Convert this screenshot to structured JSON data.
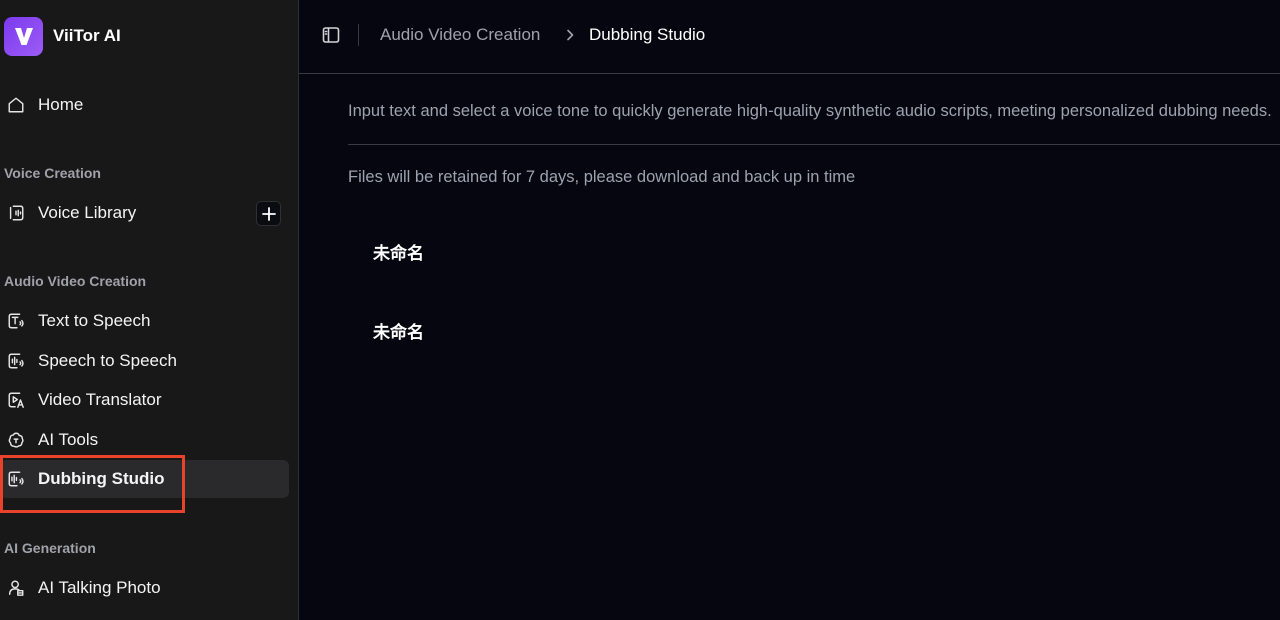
{
  "brand": {
    "name": "ViiTor AI",
    "accent": "#7c3aed"
  },
  "sidebar": {
    "home": {
      "label": "Home",
      "icon": "home-icon"
    },
    "sections": [
      {
        "title": "Voice Creation",
        "items": [
          {
            "label": "Voice Library",
            "icon": "voice-library-icon"
          }
        ]
      },
      {
        "title": "Audio Video Creation",
        "items": [
          {
            "label": "Text to Speech",
            "icon": "text-to-speech-icon"
          },
          {
            "label": "Speech to Speech",
            "icon": "speech-to-speech-icon"
          },
          {
            "label": "Video Translator",
            "icon": "video-translator-icon"
          },
          {
            "label": "AI Tools",
            "icon": "ai-tools-icon"
          },
          {
            "label": "Dubbing Studio",
            "icon": "dubbing-studio-icon",
            "active": true
          }
        ]
      },
      {
        "title": "AI Generation",
        "items": [
          {
            "label": "AI Talking Photo",
            "icon": "talking-photo-icon"
          }
        ]
      }
    ],
    "highlight_color": "#e8432a"
  },
  "header": {
    "breadcrumb": [
      "Audio Video Creation",
      "Dubbing Studio"
    ]
  },
  "main": {
    "description": "Input text and select a voice tone to quickly generate high-quality synthetic audio scripts, meeting personalized dubbing needs.",
    "retention_note": "Files will be retained for 7 days, please download and back up in time",
    "projects": [
      {
        "name": "未命名"
      },
      {
        "name": "未命名"
      }
    ]
  }
}
